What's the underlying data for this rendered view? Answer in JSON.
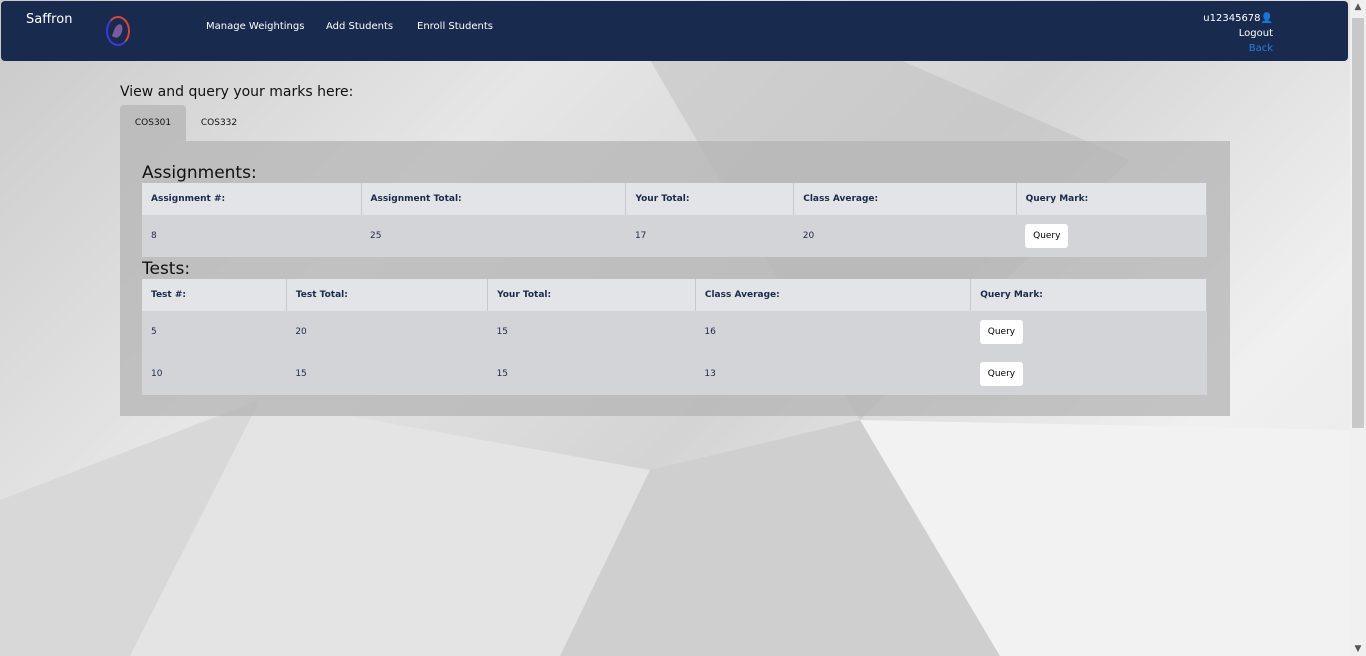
{
  "nav": {
    "brand": "Saffron",
    "links": [
      "Manage Weightings",
      "Add Students",
      "Enroll Students"
    ],
    "username": "u12345678",
    "logout": "Logout",
    "back": "Back"
  },
  "page": {
    "heading": "View and query your marks here:",
    "tabs": [
      "COS301",
      "COS332"
    ],
    "active_tab": "COS301"
  },
  "assignments": {
    "title": "Assignments:",
    "headers": [
      "Assignment #:",
      "Assignment Total:",
      "Your Total:",
      "Class Average:",
      "Query Mark:"
    ],
    "rows": [
      [
        "8",
        "25",
        "17",
        "20",
        "Query"
      ]
    ]
  },
  "tests": {
    "title": "Tests:",
    "headers": [
      "Test #:",
      "Test Total:",
      "Your Total:",
      "Class Average:",
      "Query Mark:"
    ],
    "rows": [
      [
        "5",
        "20",
        "15",
        "16",
        "Query"
      ],
      [
        "10",
        "15",
        "15",
        "13",
        "Query"
      ]
    ]
  }
}
